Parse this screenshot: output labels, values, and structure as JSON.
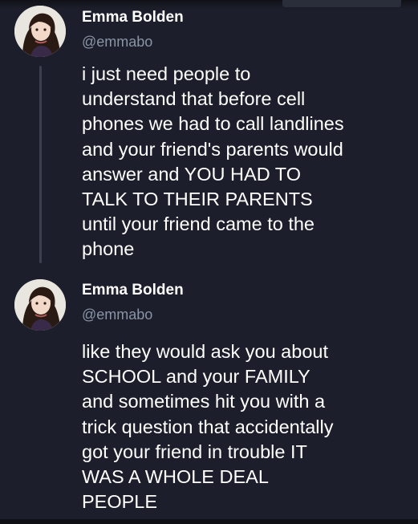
{
  "tweets": [
    {
      "author_name": "Emma Bolden",
      "author_handle": "@emmabo",
      "avatar": "profile-photo",
      "lines": [
        "i just need people to",
        "understand that before cell",
        "phones we had to call landlines",
        "and your friend's parents would",
        "answer and YOU HAD TO",
        "TALK TO THEIR PARENTS",
        "until your friend came to the",
        "phone"
      ]
    },
    {
      "author_name": "Emma Bolden",
      "author_handle": "@emmabo",
      "avatar": "profile-photo",
      "lines": [
        "like they would ask you about",
        "SCHOOL and your FAMILY",
        "and sometimes hit you with a",
        "trick question that accidentally",
        "got your friend in trouble IT",
        "WAS A WHOLE DEAL",
        "PEOPLE"
      ]
    }
  ],
  "colors": {
    "background": "#1c1f2b",
    "text": "#ffffff",
    "handle": "#8a94a6",
    "thread_line": "#3b4050"
  }
}
